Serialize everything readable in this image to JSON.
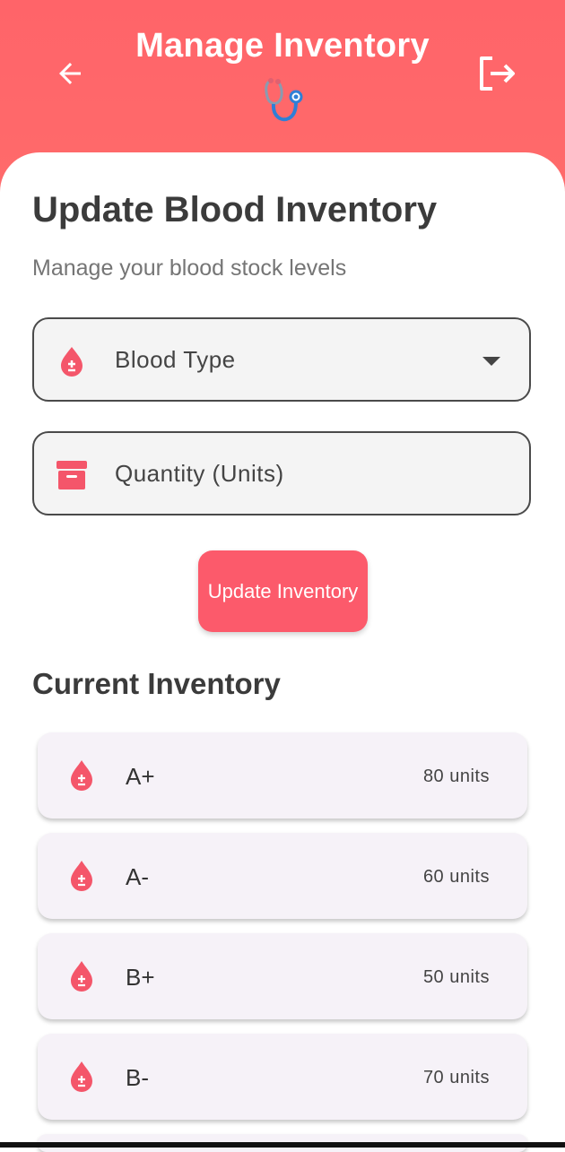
{
  "header": {
    "title": "Manage Inventory",
    "back_icon": "arrow-left-icon",
    "logout_icon": "logout-icon",
    "logo_icon": "stethoscope-icon",
    "color": "#ff6469"
  },
  "form": {
    "heading": "Update Blood Inventory",
    "subheading": "Manage your blood stock levels",
    "blood_type": {
      "label": "Blood Type",
      "icon": "blood-drop-icon"
    },
    "quantity": {
      "label": "Quantity (Units)",
      "icon": "archive-box-icon"
    },
    "submit_label": "Update Inventory",
    "accent": "#fc5a6b"
  },
  "inventory": {
    "heading": "Current Inventory",
    "items": [
      {
        "type": "A+",
        "units": "80 units"
      },
      {
        "type": "A-",
        "units": "60 units"
      },
      {
        "type": "B+",
        "units": "50 units"
      },
      {
        "type": "B-",
        "units": "70 units"
      }
    ]
  }
}
